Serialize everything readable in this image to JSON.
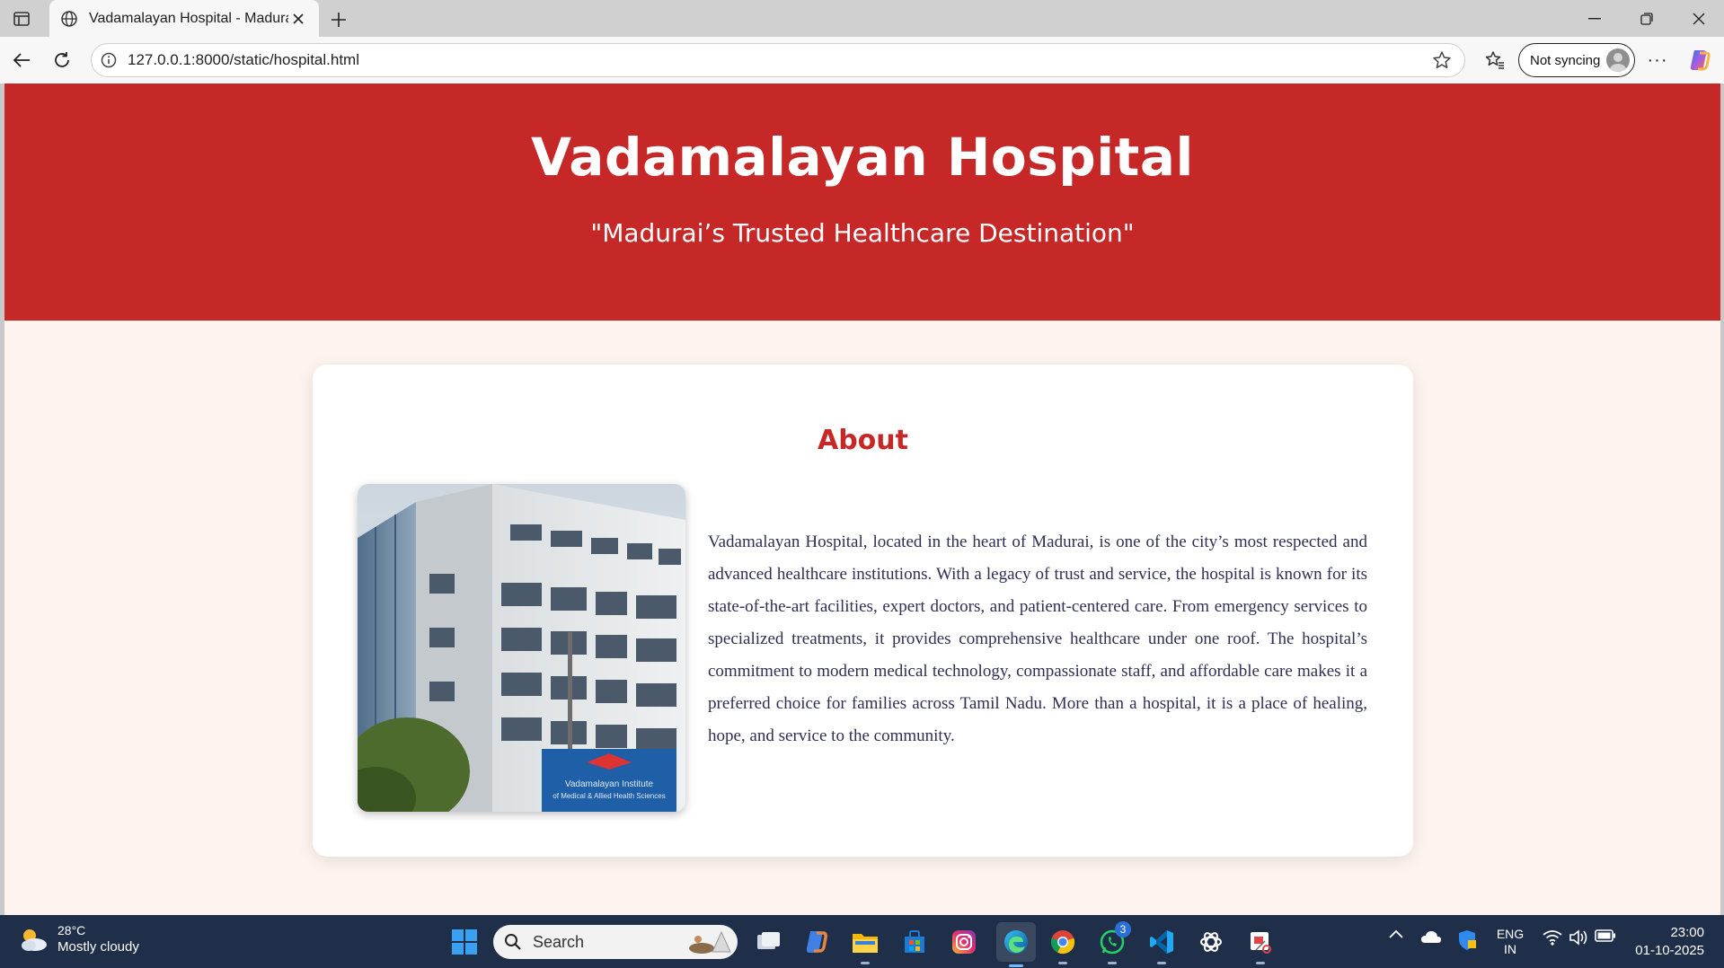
{
  "browser": {
    "tab_title": "Vadamalayan Hospital - Madurai",
    "url": "127.0.0.1:8000/static/hospital.html",
    "profile_label": "Not syncing",
    "more_label": "···"
  },
  "page": {
    "hero_title": "Vadamalayan Hospital",
    "hero_tagline": "\"Madurai’s Trusted Healthcare Destination\"",
    "about_heading": "About",
    "about_text": "Vadamalayan Hospital, located in the heart of Madurai, is one of the city’s most respected and advanced healthcare institutions. With a legacy of trust and service, the hospital is known for its state-of-the-art facilities, expert doctors, and patient-centered care. From emergency services to specialized treatments, it provides comprehensive healthcare under one roof. The hospital’s commitment to modern medical technology, compassionate staff, and affordable care makes it a preferred choice for families across Tamil Nadu. More than a hospital, it is a place of healing, hope, and service to the community.",
    "image_sign_line1": "Vadamalayan Institute",
    "image_sign_line2": "of Medical & Allied Health Sciences",
    "colors": {
      "primary": "#c62828",
      "background": "#fdf3ef",
      "text": "#2f2f54"
    }
  },
  "taskbar": {
    "weather_temp": "28°C",
    "weather_condition": "Mostly cloudy",
    "search_label": "Search",
    "whatsapp_badge": "3",
    "lang_primary": "ENG",
    "lang_secondary": "IN",
    "time": "23:00",
    "date": "01-10-2025"
  }
}
